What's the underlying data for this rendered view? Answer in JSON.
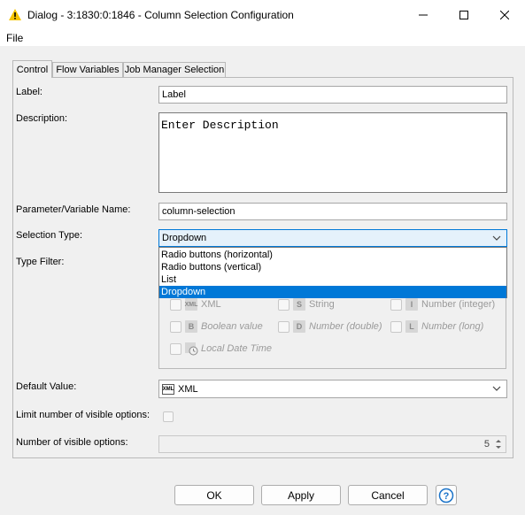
{
  "window": {
    "title": "Dialog - 3:1830:0:1846 - Column Selection Configuration",
    "minimize_icon": "minimize-icon",
    "maximize_icon": "maximize-icon",
    "close_icon": "close-icon"
  },
  "menu": {
    "file": "File"
  },
  "tabs": [
    "Control",
    "Flow Variables",
    "Job Manager Selection"
  ],
  "form": {
    "label_caption": "Label:",
    "label_value": "Label",
    "description_caption": "Description:",
    "description_value": "Enter Description",
    "param_caption": "Parameter/Variable Name:",
    "param_value": "column-selection",
    "selection_type_caption": "Selection Type:",
    "selection_type_value": "Dropdown",
    "selection_type_options": [
      "Radio buttons (horizontal)",
      "Radio buttons (vertical)",
      "List",
      "Dropdown"
    ],
    "type_filter_caption": "Type Filter:",
    "type_filter": [
      {
        "label": "XML",
        "icon": "XML",
        "italic": false
      },
      {
        "label": "String",
        "icon": "S",
        "italic": false
      },
      {
        "label": "Number (integer)",
        "icon": "I",
        "italic": false
      },
      {
        "label": "Boolean value",
        "icon": "B",
        "italic": true
      },
      {
        "label": "Number (double)",
        "icon": "D",
        "italic": true
      },
      {
        "label": "Number (long)",
        "icon": "L",
        "italic": true
      },
      {
        "label": "Local Date Time",
        "icon": "clock",
        "italic": true
      }
    ],
    "default_value_caption": "Default Value:",
    "default_value": "XML",
    "default_value_icon": "XML",
    "limit_caption": "Limit number of visible options:",
    "visible_options_caption": "Number of visible options:",
    "visible_options_value": "5"
  },
  "buttons": {
    "ok": "OK",
    "apply": "Apply",
    "cancel": "Cancel"
  },
  "colors": {
    "accent": "#0078d7",
    "warning": "#f5c400"
  }
}
